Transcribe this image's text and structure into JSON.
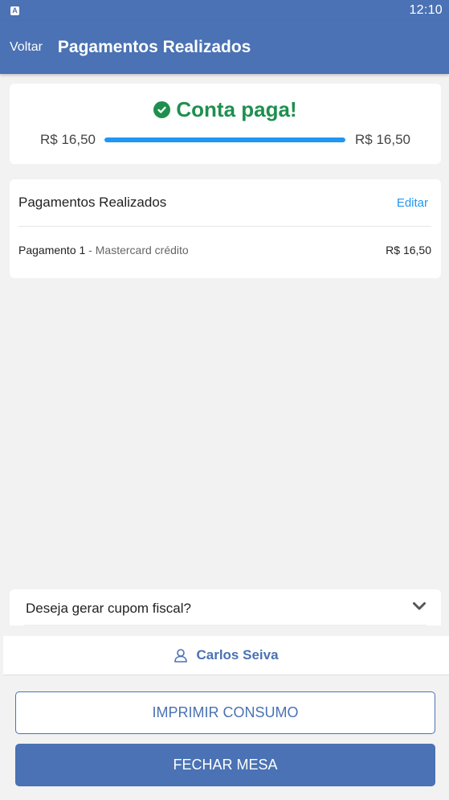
{
  "status_bar": {
    "app_icon_letter": "A",
    "time": "12:10"
  },
  "header": {
    "back_label": "Voltar",
    "title": "Pagamentos Realizados"
  },
  "summary": {
    "status_title": "Conta paga!",
    "paid_amount": "R$ 16,50",
    "total_amount": "R$ 16,50",
    "progress_fraction": 1.0
  },
  "payments": {
    "title": "Pagamentos Realizados",
    "edit_label": "Editar",
    "items": [
      {
        "name": "Pagamento 1",
        "separator": " - ",
        "method": "Mastercard crédito",
        "amount": "R$ 16,50"
      }
    ]
  },
  "fiscal": {
    "question": "Deseja gerar cupom fiscal?"
  },
  "waiter": {
    "name": "Carlos Seiva"
  },
  "actions": {
    "print_label": "IMPRIMIR CONSUMO",
    "close_label": "FECHAR MESA"
  },
  "colors": {
    "primary": "#4a72b4",
    "success": "#1f8f4f",
    "link": "#2196f3",
    "background": "#f2f2f2"
  },
  "icons": {
    "status": "app-notification-icon",
    "paid": "check-circle-icon",
    "fiscal_toggle": "chevron-down-icon",
    "waiter": "user-icon"
  }
}
